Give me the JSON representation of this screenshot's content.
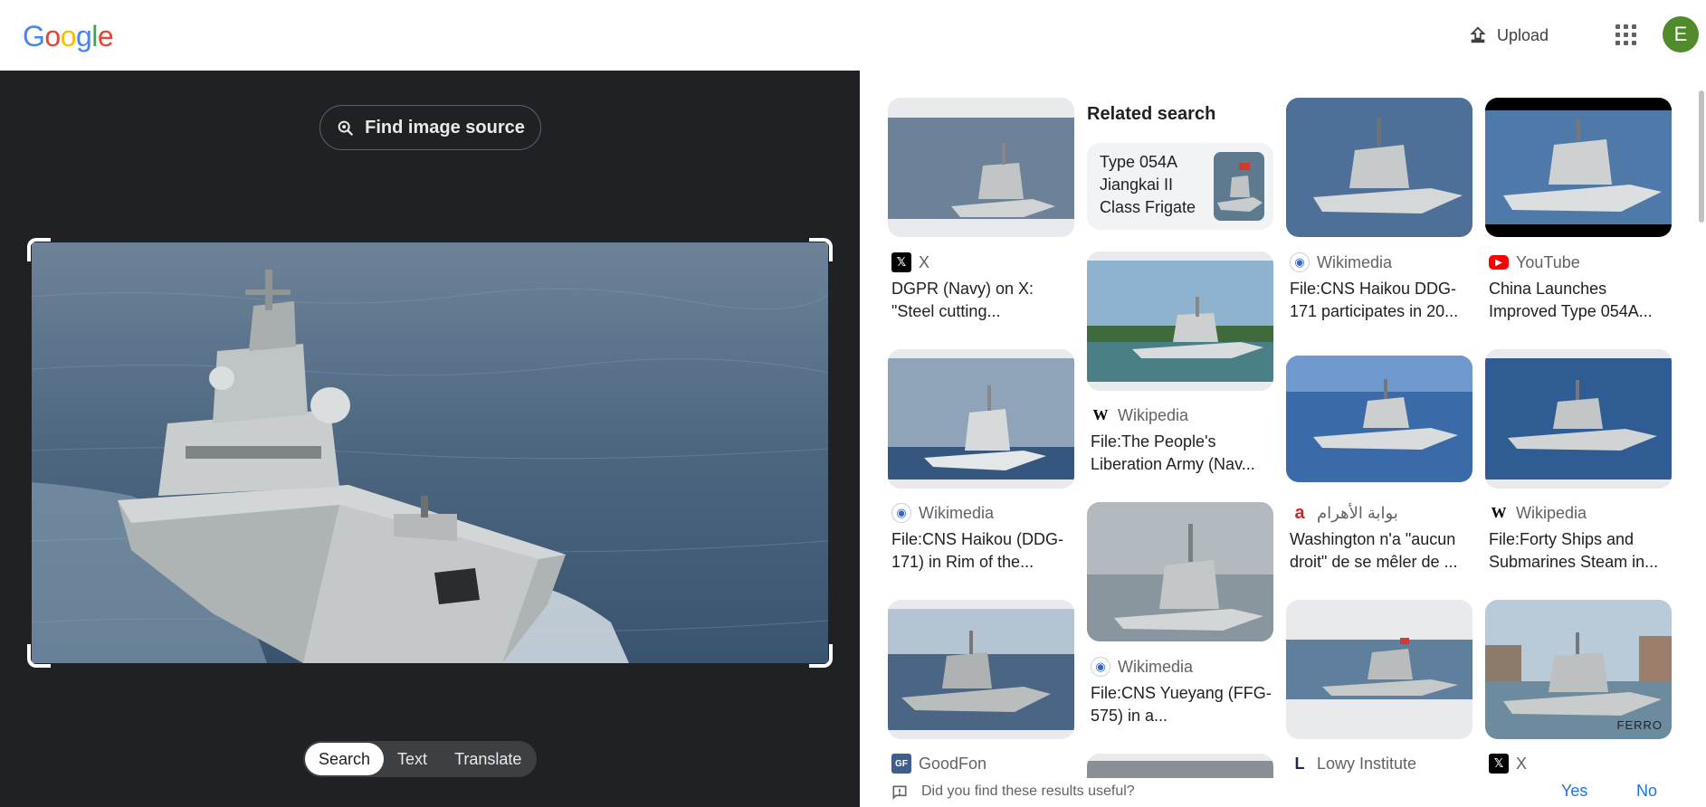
{
  "header": {
    "logo_letters": [
      "G",
      "o",
      "o",
      "g",
      "l",
      "e"
    ],
    "upload_label": "Upload",
    "avatar_initial": "E"
  },
  "lens": {
    "find_source_label": "Find image source",
    "modes": [
      "Search",
      "Text",
      "Translate"
    ],
    "active_mode": "Search"
  },
  "related": {
    "heading": "Related search",
    "chip_text": "Type 054A Jiangkai II Class Frigate"
  },
  "results": [
    {
      "source": "X",
      "title": "DGPR (Navy) on X: \"Steel cutting..."
    },
    {
      "source": "Wikimedia",
      "title": "File:CNS Haikou DDG-171 participates in 20..."
    },
    {
      "source": "YouTube",
      "title": "China Launches Improved Type 054A..."
    },
    {
      "source": "Wikipedia",
      "title": "File:The People's Liberation Army (Nav..."
    },
    {
      "source": "Wikimedia",
      "title": "File:CNS Haikou (DDG-171) in Rim of the..."
    },
    {
      "source": "بوابة الأهرام",
      "title": "Washington n'a \"aucun droit\" de se mêler de ..."
    },
    {
      "source": "Wikipedia",
      "title": "File:Forty Ships and Submarines Steam in..."
    },
    {
      "source": "Wikimedia",
      "title": "File:CNS Yueyang (FFG-575) in a..."
    },
    {
      "source": "GoodFon",
      "title": ""
    },
    {
      "source": "Lowy Institute",
      "title": ""
    },
    {
      "source": "X",
      "title": ""
    }
  ],
  "watermark": "FERRO",
  "feedback": {
    "question": "Did you find these results useful?",
    "yes": "Yes",
    "no": "No"
  },
  "colors": {
    "panel_dark": "#202124",
    "link_blue": "#1a73e8",
    "avatar_green": "#4f8a2b"
  }
}
